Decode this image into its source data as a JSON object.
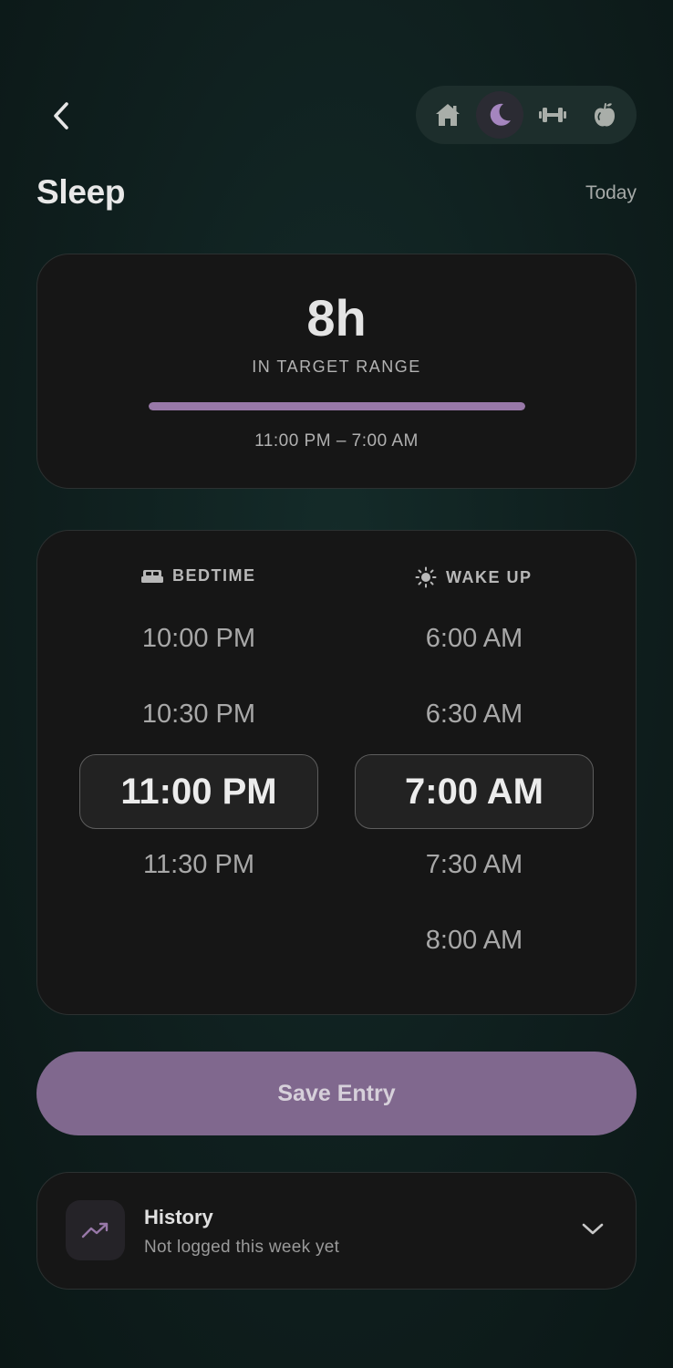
{
  "header": {
    "title": "Sleep",
    "date": "Today",
    "nav": [
      {
        "icon": "home-icon",
        "active": false
      },
      {
        "icon": "moon-icon",
        "active": true
      },
      {
        "icon": "dumbbell-icon",
        "active": false
      },
      {
        "icon": "apple-icon",
        "active": false
      }
    ]
  },
  "summary": {
    "duration": "8h",
    "status": "IN TARGET RANGE",
    "range": "11:00 PM – 7:00 AM",
    "progress_fraction": 1.0
  },
  "picker": {
    "bedtime": {
      "label": "BEDTIME",
      "icon": "bed-icon",
      "options": [
        "10:00 PM",
        "10:30 PM",
        "11:00 PM",
        "11:30 PM"
      ],
      "selected": "11:00 PM"
    },
    "wakeup": {
      "label": "WAKE UP",
      "icon": "sun-icon",
      "options": [
        "6:00 AM",
        "6:30 AM",
        "7:00 AM",
        "7:30 AM",
        "8:00 AM"
      ],
      "selected": "7:00 AM"
    }
  },
  "save_label": "Save Entry",
  "history": {
    "title": "History",
    "subtitle": "Not logged this week yet",
    "icon": "trend-up-icon"
  },
  "colors": {
    "accent": "#9878a8",
    "button": "#80688e",
    "card": "#161616",
    "background": "#0f1f1e"
  }
}
